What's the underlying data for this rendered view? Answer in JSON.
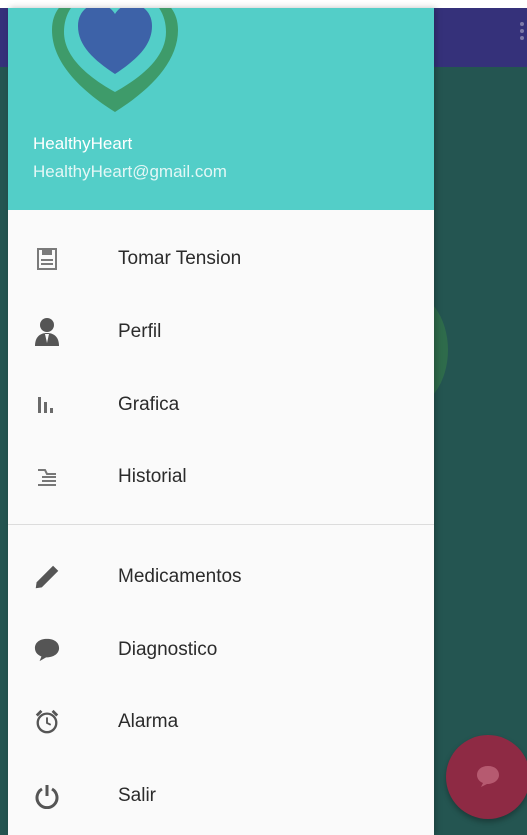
{
  "header": {
    "user_name": "HealthyHeart",
    "user_email": "HealthyHeart@gmail.com"
  },
  "menu_primary": [
    {
      "label": "Tomar Tension",
      "icon": "save-icon"
    },
    {
      "label": "Perfil",
      "icon": "person-icon"
    },
    {
      "label": "Grafica",
      "icon": "bar-chart-icon"
    },
    {
      "label": "Historial",
      "icon": "history-icon"
    }
  ],
  "menu_secondary": [
    {
      "label": "Medicamentos",
      "icon": "pencil-icon"
    },
    {
      "label": "Diagnostico",
      "icon": "chat-icon"
    },
    {
      "label": "Alarma",
      "icon": "alarm-icon"
    },
    {
      "label": "Salir",
      "icon": "power-icon"
    }
  ],
  "colors": {
    "header_bg": "#53cec8",
    "toolbar_bg": "#35317a",
    "background_dim": "#245551",
    "fab": "#8e2a44",
    "logo_outer": "#3e9b6a",
    "logo_inner": "#3d62a8"
  }
}
